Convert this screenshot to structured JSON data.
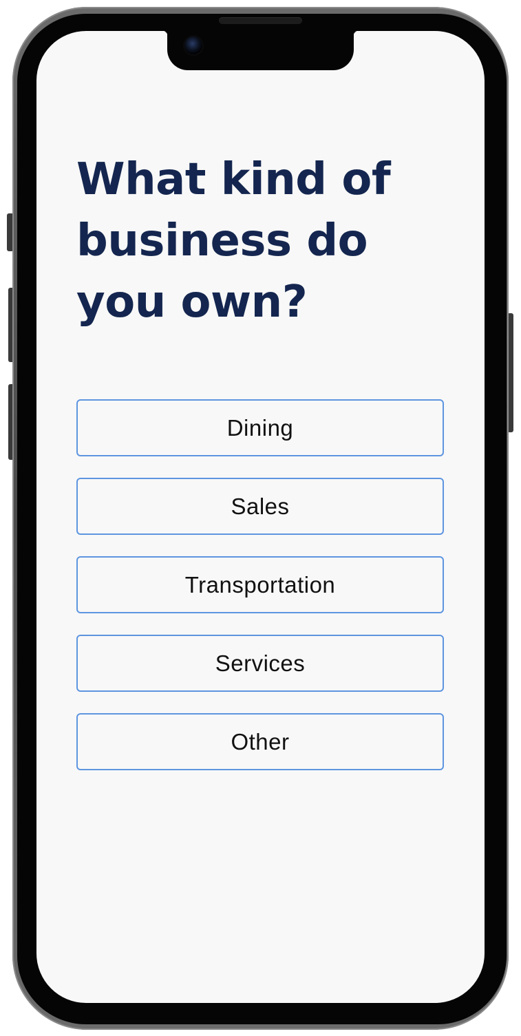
{
  "question": {
    "title": "What kind of business do you own?"
  },
  "options": [
    {
      "label": "Dining"
    },
    {
      "label": "Sales"
    },
    {
      "label": "Transportation"
    },
    {
      "label": "Services"
    },
    {
      "label": "Other"
    }
  ],
  "colors": {
    "title": "#14264f",
    "option_border": "#5d95e0",
    "screen_background": "#f8f8f8"
  }
}
